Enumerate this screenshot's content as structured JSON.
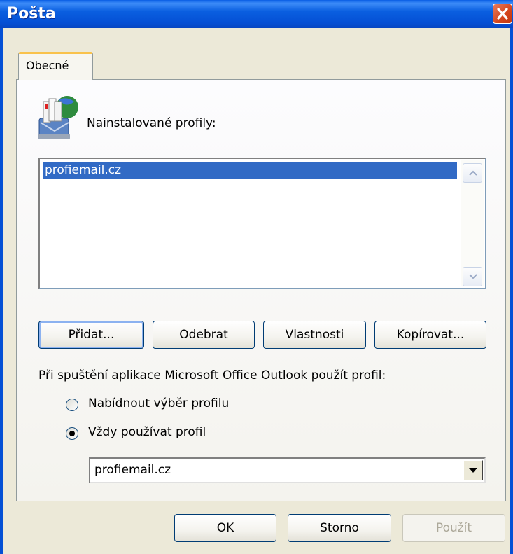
{
  "window": {
    "title": "Pošta"
  },
  "tabs": [
    {
      "label": "Obecné"
    }
  ],
  "profiles": {
    "heading": "Nainstalované profily:",
    "items": [
      "profiemail.cz"
    ]
  },
  "buttons": {
    "add": "Přidat...",
    "remove": "Odebrat",
    "properties": "Vlastnosti",
    "copy": "Kopírovat..."
  },
  "startup": {
    "label": "Při spuštění aplikace Microsoft Office Outlook použít profil:",
    "option_prompt": "Nabídnout výběr profilu",
    "option_always": "Vždy používat profil",
    "selected_option": "always",
    "selected_profile": "profiemail.cz"
  },
  "footer": {
    "ok": "OK",
    "cancel": "Storno",
    "apply": "Použít"
  },
  "colors": {
    "titlebar": "#0550d5",
    "selection": "#316ac5",
    "close": "#d3451c"
  }
}
